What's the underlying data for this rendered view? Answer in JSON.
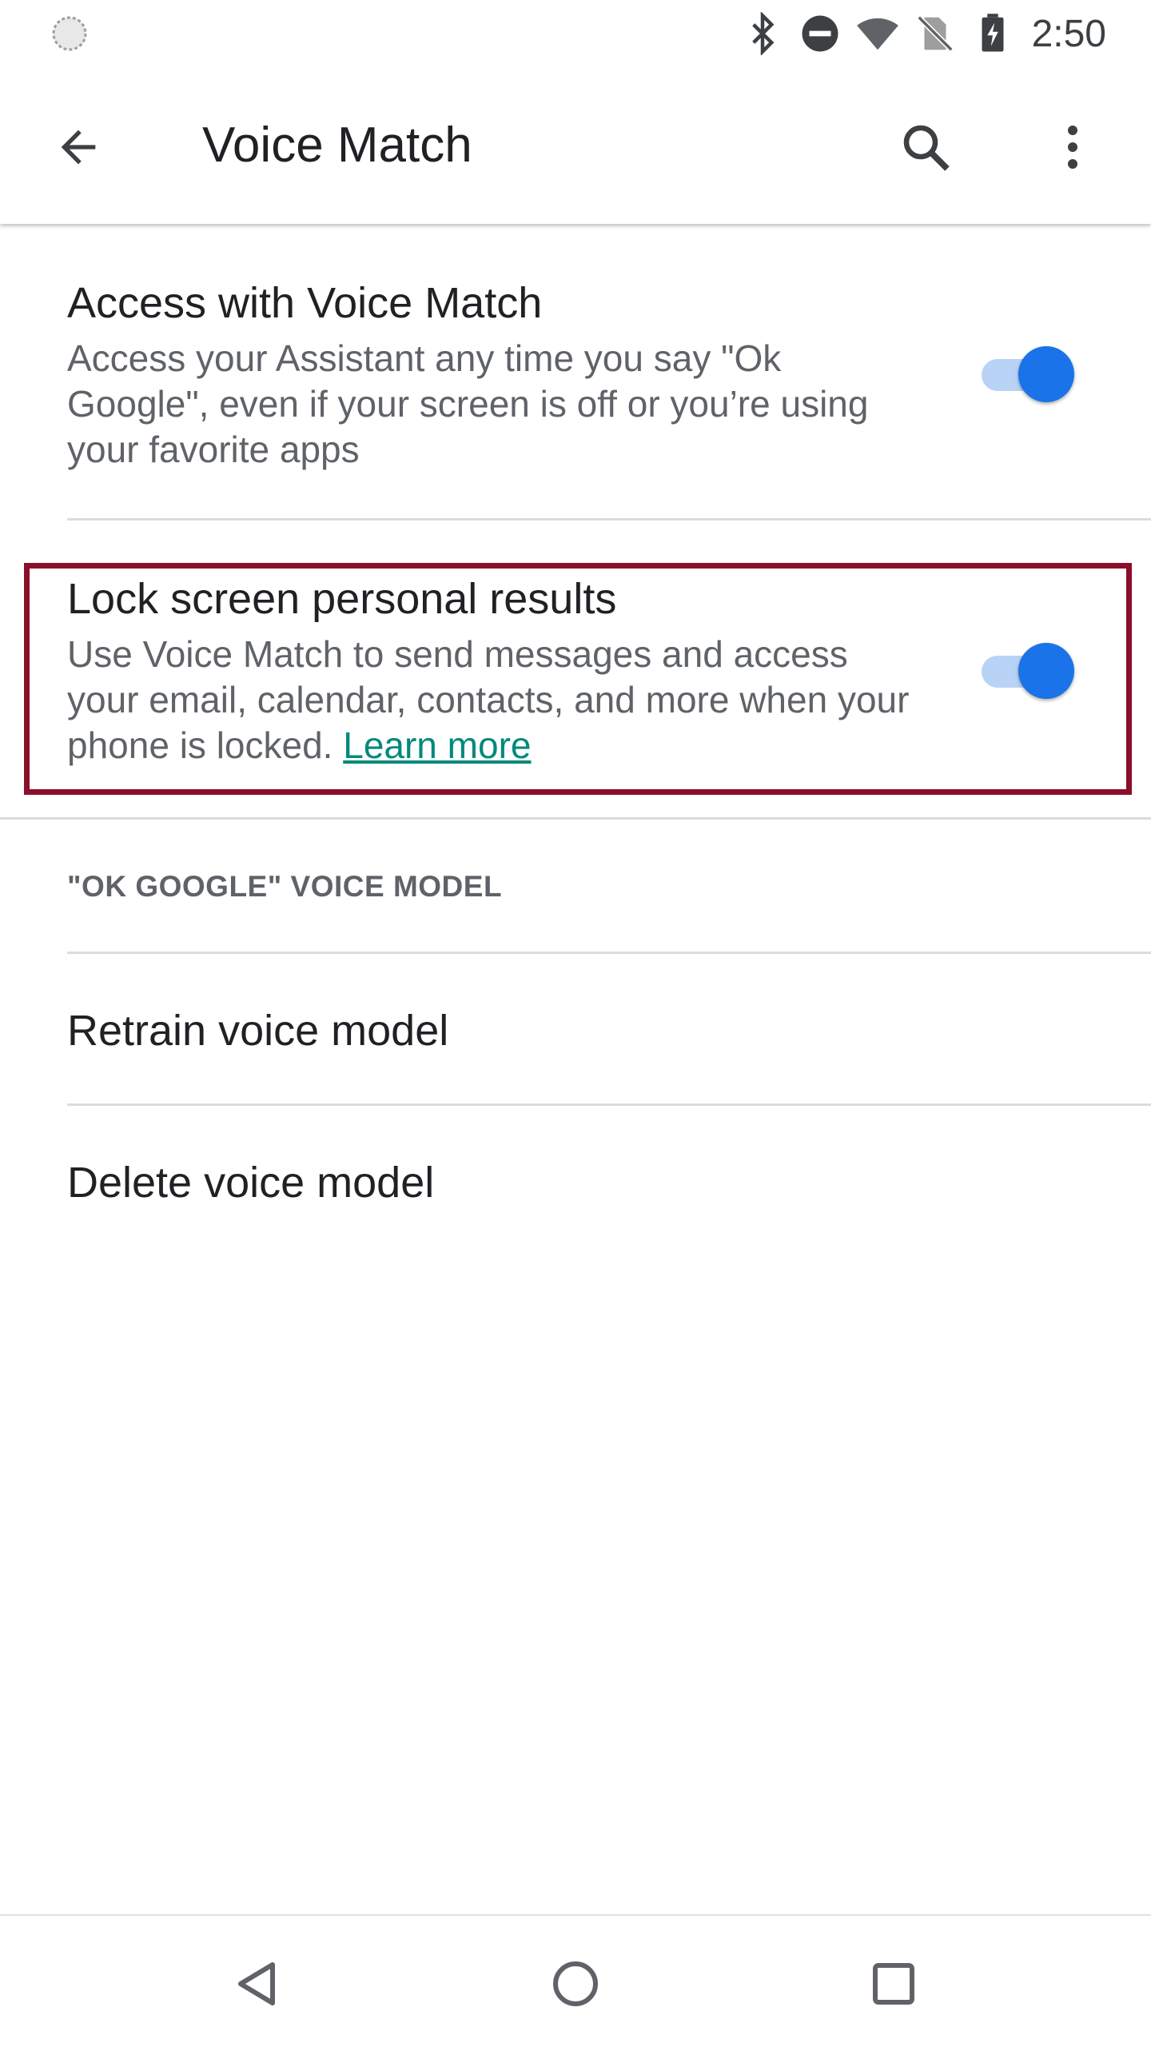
{
  "status_bar": {
    "time": "2:50",
    "icons": [
      "sync-icon",
      "bluetooth-icon",
      "do-not-disturb-icon",
      "wifi-icon",
      "no-sim-icon",
      "battery-charging-icon"
    ]
  },
  "app_bar": {
    "title": "Voice Match",
    "back_icon": "back-arrow-icon",
    "search_icon": "search-icon",
    "more_icon": "more-vert-icon"
  },
  "settings": [
    {
      "title": "Access with Voice Match",
      "summary": "Access your Assistant any time you say \"Ok Google\", even if your screen is off or you’re using your favorite apps",
      "toggle_on": true
    },
    {
      "title": "Lock screen personal results",
      "summary": "Use Voice Match to send messages and access your email, calendar, contacts, and more when your phone is locked.",
      "link": "Learn more",
      "toggle_on": true
    }
  ],
  "section_header": "\"OK GOOGLE\" VOICE MODEL",
  "list_items": [
    "Retrain voice model",
    "Delete voice model"
  ],
  "nav_bar": {
    "icons": [
      "nav-back-icon",
      "nav-home-icon",
      "nav-recents-icon"
    ]
  },
  "colors": {
    "accent": "#1a73e8",
    "toggle_track": "#b9d3f7",
    "link": "#00897b",
    "highlight_border": "#8b0f2a"
  }
}
